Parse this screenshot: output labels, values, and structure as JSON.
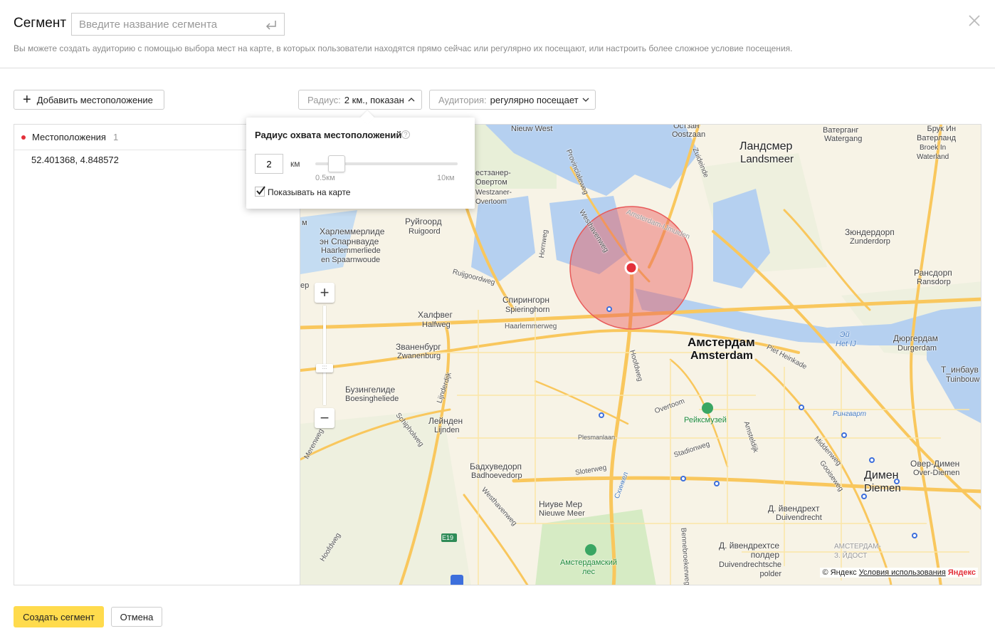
{
  "header": {
    "title": "Сегмент",
    "name_placeholder": "Введите название сегмента",
    "hint": "Вы можете создать аудиторию с помощью выбора мест на карте, в которых пользователи находятся прямо сейчас или регулярно их посещают, или настроить более сложное условие посещения."
  },
  "toolbar": {
    "add_location_label": "Добавить местоположение",
    "radius_label": "Радиус:",
    "radius_value": "2 км., показан",
    "audience_label": "Аудитория:",
    "audience_value": "регулярно посещает"
  },
  "locations": {
    "header": "Местоположения",
    "count": "1",
    "items": [
      {
        "coords": "52.401368, 4.848572"
      }
    ]
  },
  "radius_popup": {
    "title": "Радиус охвата местоположений",
    "help": "?",
    "value": "2",
    "unit": "км",
    "min_label": "0.5км",
    "max_label": "10км",
    "show_on_map_label": "Показывать на карте",
    "show_on_map": true
  },
  "map": {
    "labels": {
      "nieuw_west": "Nieuw West",
      "ostzan_ru": "Остзан",
      "ostzan": "Oostzaan",
      "watergang_ru": "Ватерганг",
      "watergang": "Watergang",
      "broek_ru": "Брук Ин\nВатерланд",
      "broek": "Broek In\nWaterland",
      "landsmeer_ru": "Ландсмер",
      "landsmeer": "Landsmeer",
      "westzaner_ru": "естзанер-\nОвертом",
      "westzaner": "Westzaner-\nOvertoom",
      "harlem_ru": "Харлеммерлиде\nэн Спарнвауде",
      "harlem": "Haarlemmerliede\nen Spaarnwoude",
      "ruigoord_ru": "Руйгоорд",
      "ruigoord": "Ruigoord",
      "zunderdorp_ru": "Зюндердорп",
      "zunderdorp": "Zunderdorp",
      "ransdorp_ru": "Рансдорп",
      "ransdorp": "Ransdorp",
      "spieringhorn_ru": "Спирингорн",
      "spieringhorn": "Spieringhorn",
      "halfweg_ru": "Халфвег",
      "halfweg": "Halfweg",
      "amsterdam_ru": "Амстердам",
      "amsterdam": "Amsterdam",
      "het_ij_ru": "Эй",
      "het_ij": "Het IJ",
      "durgerdam_ru": "Дюргердам",
      "durgerdam": "Durgerdam",
      "tuinbouw_ru": "Т_инбаув",
      "tuinbouw": "Tuinbouw",
      "zwanenburg_ru": "Званенбург",
      "zwanenburg": "Zwanenburg",
      "boesingheliede_ru": "Бузингелиде",
      "boesingheliede": "Boesingheliede",
      "lijnden_ru": "Лейнден",
      "lijnden": "Lijnden",
      "rijksmuseum": "Рейксмузей",
      "badhoevedorp_ru": "Бадхуведорп",
      "badhoevedorp": "Badhoevedorp",
      "nieuwe_meer_ru": "Ниуве Мер",
      "nieuwe_meer": "Nieuwe Meer",
      "diemen_ru": "Димен",
      "diemen": "Diemen",
      "over_diemen_ru": "Овер-Димен",
      "over_diemen": "Over-Diemen",
      "duivendrecht_ru": "Д. йвендрехт",
      "duivendrecht": "Duivendrecht",
      "polder_ru": "Д. йвендрехтсе\nполдер",
      "polder": "Duivendrechtsche\npolder",
      "amsterdam_zuidoost": "АМСТЕРДАМ-\nЗ. ЙДОСТ",
      "amsterdamse_bos": "Амстердамский\nлес",
      "e19": "E19",
      "ringvaart": "Рингварт",
      "st_provinciale": "Provincialeweg",
      "st_westhaven": "Westhavenweg",
      "st_hornweg": "Hornweg",
      "st_ruijgoord": "Ruijgoordweg",
      "st_haarlemmer": "Haarlemmerweg",
      "st_hoofdweg": "Hoofdweg",
      "st_overtoom": "Overtoom",
      "st_piet_heinkade": "Piet Heinkade",
      "st_amsteldijk": "Amsteldijk",
      "st_middenweg": "Middenweg",
      "st_gooiseweg": "Gooiseweg",
      "st_stadionweg": "Stadionweg",
      "st_sloterweg": "Sloterweg",
      "st_plesmanlaan": "Plesmanlaan",
      "st_schiphol": "Schipholweg",
      "st_lijnderdijk": "Lijnderdijk",
      "st_zuideinde": "Zuideinde",
      "st_amsterdam_ijmuiden": "Amsterdam-IJmuiden",
      "st_westhavenweg2": "Westhavenweg",
      "st_hoofdweg2": "Hoofdweg",
      "st_schinkel": "Схинкел",
      "st_merenweg": "Merenweg",
      "st_bilderdijk": "Bennebroekerweg",
      "left_cut_1": "м",
      "left_cut_2": "ер"
    },
    "zoom_in": "+",
    "zoom_out": "−",
    "copyright": "© Яндекс",
    "terms_link": "Условия использования",
    "logo": "Яндекс",
    "circle_color": "#e85a5a",
    "water_color": "#b5d0f0",
    "road_color": "#f9c75d"
  },
  "footer": {
    "create_label": "Создать сегмент",
    "cancel_label": "Отмена"
  }
}
